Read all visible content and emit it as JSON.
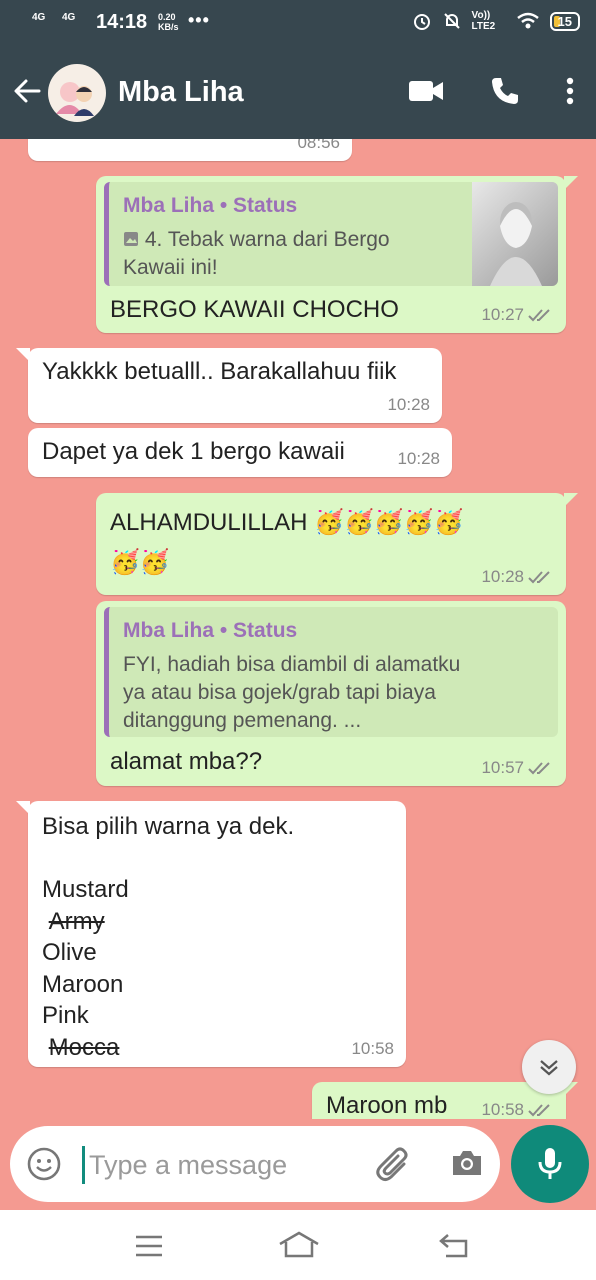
{
  "status_bar": {
    "net1": "4G",
    "net2": "4G",
    "time": "14:18",
    "speed_value": "0.20",
    "speed_unit": "KB/s",
    "dots": "•••",
    "lte": "Vo)) LTE2",
    "battery": "15"
  },
  "header": {
    "contact_name": "Mba Liha"
  },
  "messages": {
    "m0_time": "08:56",
    "m1": {
      "quote_name": "Mba Liha • Status",
      "quote_text_line1": "4. Tebak warna dari Bergo",
      "quote_text_line2": "Kawaii ini!",
      "text": "BERGO KAWAII CHOCHO",
      "time": "10:27"
    },
    "m2": {
      "text": "Yakkkk betualll.. Barakallahuu fiik",
      "time": "10:28"
    },
    "m3": {
      "text": "Dapet ya dek 1 bergo kawaii",
      "time": "10:28"
    },
    "m4": {
      "text": "ALHAMDULILLAH",
      "emoji_line1": "🥳🥳🥳🥳🥳",
      "emoji_line2": "🥳🥳",
      "time": "10:28"
    },
    "m5": {
      "quote_name": "Mba Liha • Status",
      "quote_line1": "FYI, hadiah bisa diambil di alamatku",
      "quote_line2": "ya atau bisa gojek/grab tapi biaya",
      "quote_line3": "ditanggung pemenang. ...",
      "text": "alamat mba??",
      "time": "10:57"
    },
    "m6": {
      "intro": "Bisa pilih warna ya dek.",
      "colors": [
        "Mustard",
        "Army",
        "Olive",
        "Maroon",
        "Pink",
        "Mocca"
      ],
      "time": "10:58"
    },
    "m7": {
      "text": "Maroon mb",
      "time": "10:58"
    }
  },
  "composer": {
    "placeholder": "Type a message"
  }
}
